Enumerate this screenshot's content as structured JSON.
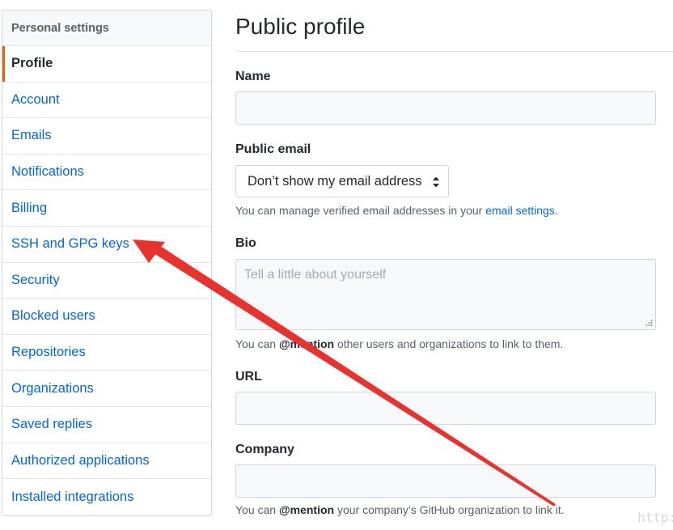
{
  "sidebar": {
    "header": "Personal settings",
    "items": [
      {
        "label": "Profile",
        "selected": true
      },
      {
        "label": "Account"
      },
      {
        "label": "Emails"
      },
      {
        "label": "Notifications"
      },
      {
        "label": "Billing"
      },
      {
        "label": "SSH and GPG keys"
      },
      {
        "label": "Security"
      },
      {
        "label": "Blocked users"
      },
      {
        "label": "Repositories"
      },
      {
        "label": "Organizations"
      },
      {
        "label": "Saved replies"
      },
      {
        "label": "Authorized applications"
      },
      {
        "label": "Installed integrations"
      }
    ]
  },
  "main": {
    "title": "Public profile",
    "name": {
      "label": "Name",
      "value": ""
    },
    "public_email": {
      "label": "Public email",
      "selected": "Don’t show my email address",
      "note_prefix": "You can manage verified email addresses in your ",
      "note_link": "email settings",
      "note_suffix": "."
    },
    "bio": {
      "label": "Bio",
      "placeholder": "Tell a little about yourself",
      "note_prefix": "You can ",
      "note_mention": "@mention",
      "note_suffix": " other users and organizations to link to them."
    },
    "url": {
      "label": "URL",
      "value": ""
    },
    "company": {
      "label": "Company",
      "value": "",
      "note_prefix": "You can ",
      "note_mention": "@mention",
      "note_suffix": " your company’s GitHub organization to link it."
    }
  },
  "annotation": {
    "arrow_color": "#e8322d",
    "arrow_target": "SSH and GPG keys"
  },
  "watermark": "http:"
}
